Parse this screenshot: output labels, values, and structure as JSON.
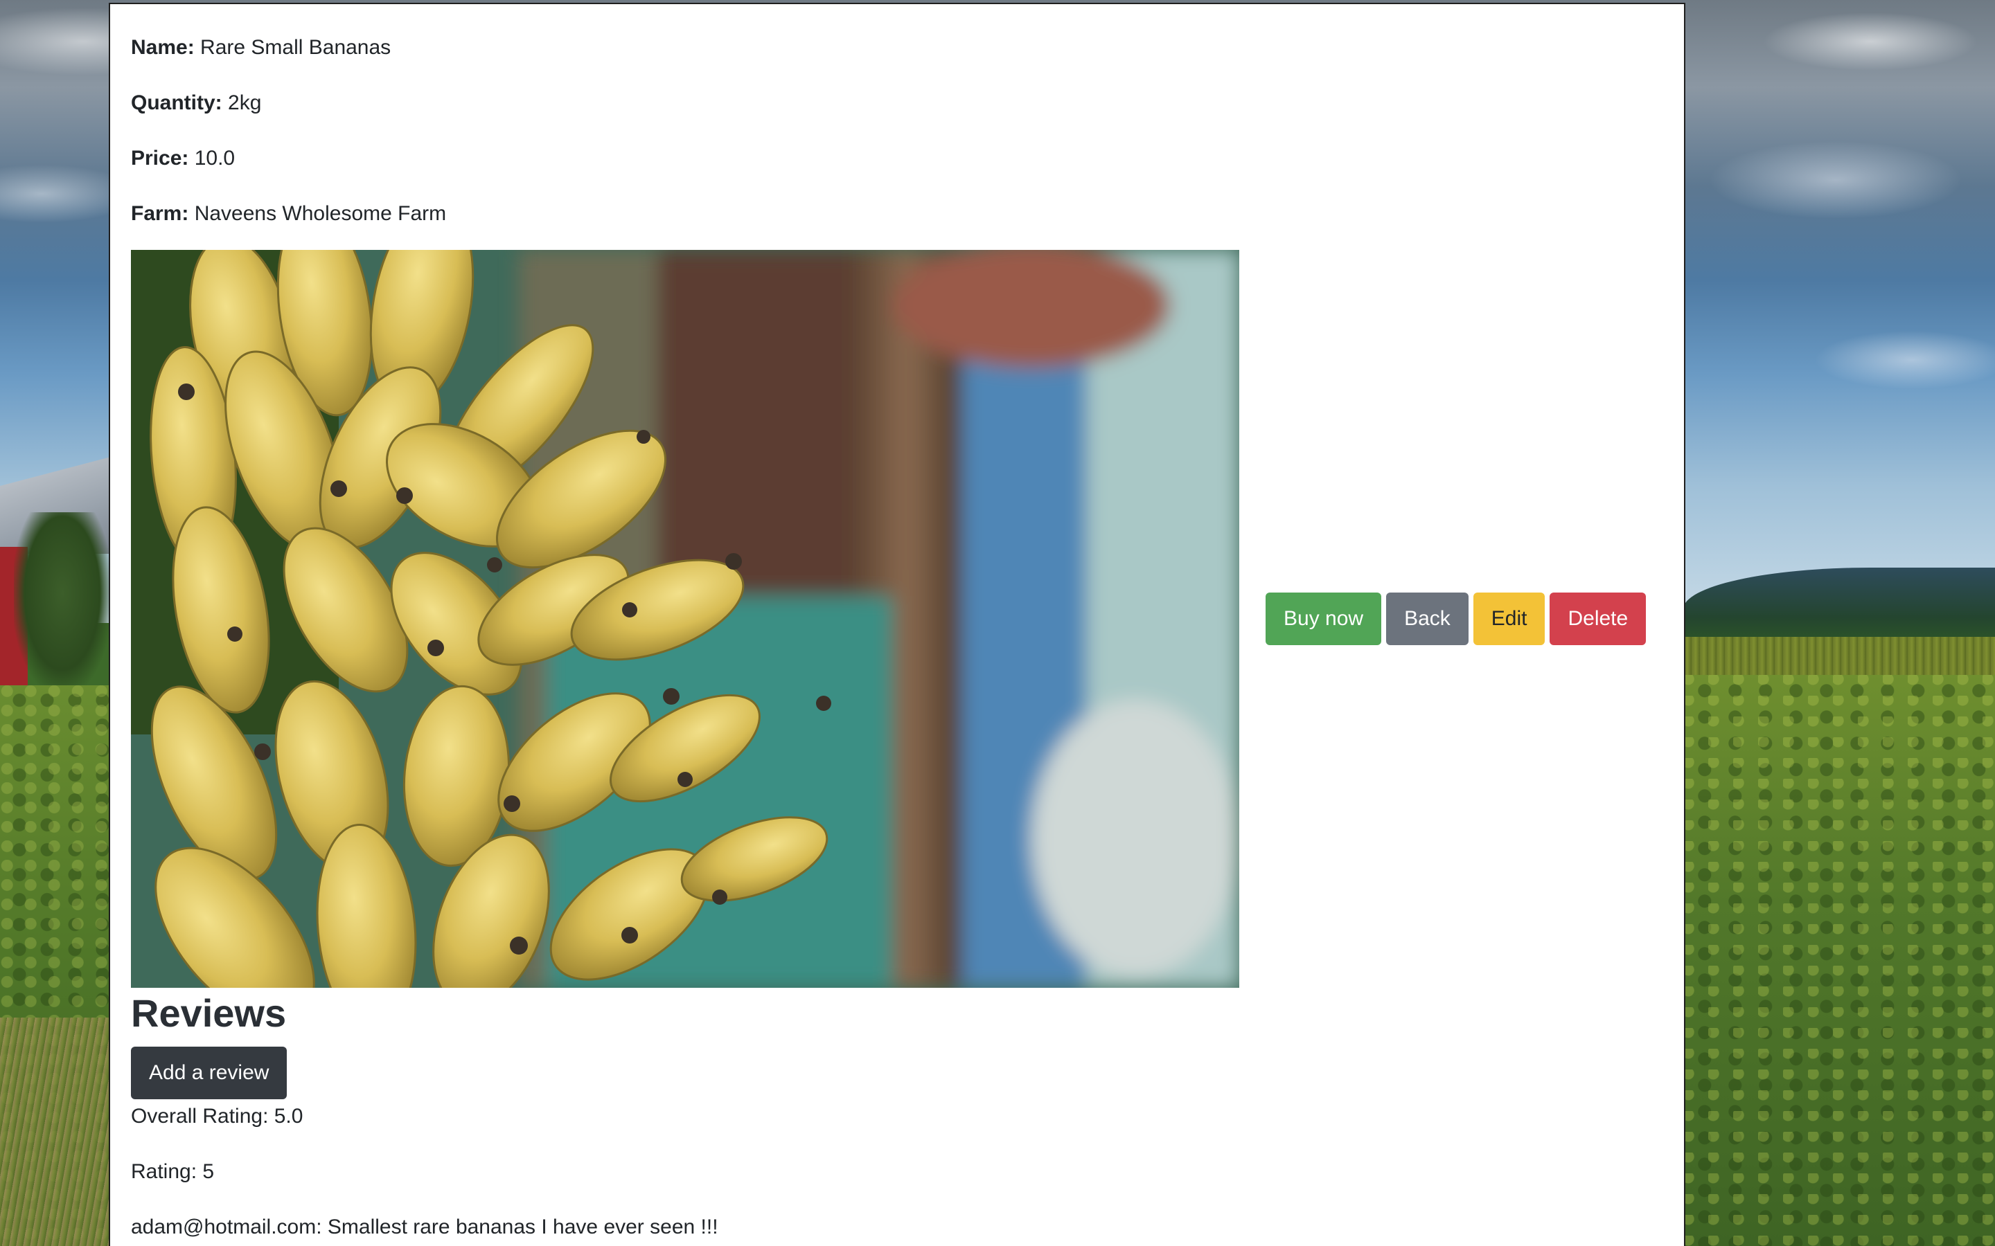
{
  "product": {
    "name_label": "Name:",
    "name_value": " Rare Small Bananas",
    "quantity_label": "Quantity:",
    "quantity_value": " 2kg",
    "price_label": "Price:",
    "price_value": " 10.0",
    "farm_label": "Farm:",
    "farm_value": " Naveens Wholesome Farm"
  },
  "actions": {
    "buy_label": "Buy now",
    "back_label": "Back",
    "edit_label": "Edit",
    "delete_label": "Delete"
  },
  "reviews": {
    "heading": "Reviews",
    "add_label": "Add a review",
    "overall_rating": "Overall Rating: 5.0",
    "items": [
      {
        "rating": "Rating: 5",
        "comment": "adam@hotmail.com: Smallest rare bananas I have ever seen !!!"
      }
    ]
  },
  "colors": {
    "buy": "#51a556",
    "back": "#6c737d",
    "edit": "#f3c237",
    "delete": "#d3414d",
    "add_review": "#353a40"
  }
}
